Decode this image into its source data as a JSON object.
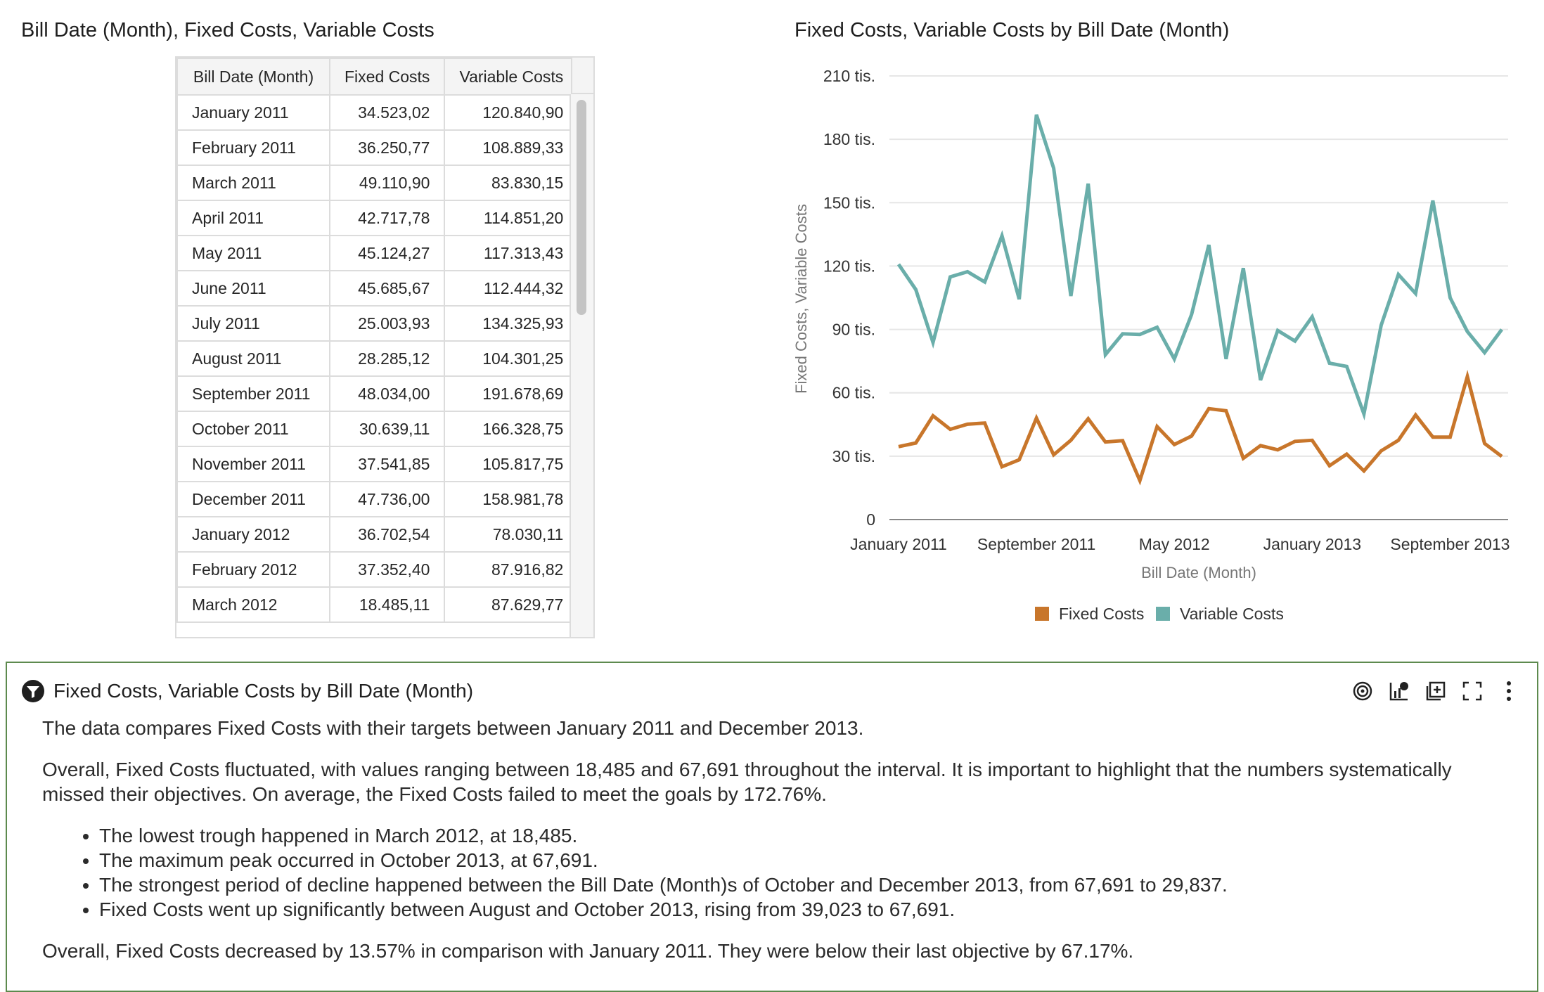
{
  "table_panel": {
    "title": "Bill Date (Month), Fixed Costs, Variable Costs",
    "columns": [
      "Bill Date (Month)",
      "Fixed Costs",
      "Variable Costs"
    ],
    "rows": [
      [
        "January 2011",
        "34.523,02",
        "120.840,90"
      ],
      [
        "February 2011",
        "36.250,77",
        "108.889,33"
      ],
      [
        "March 2011",
        "49.110,90",
        "83.830,15"
      ],
      [
        "April 2011",
        "42.717,78",
        "114.851,20"
      ],
      [
        "May 2011",
        "45.124,27",
        "117.313,43"
      ],
      [
        "June 2011",
        "45.685,67",
        "112.444,32"
      ],
      [
        "July 2011",
        "25.003,93",
        "134.325,93"
      ],
      [
        "August 2011",
        "28.285,12",
        "104.301,25"
      ],
      [
        "September 2011",
        "48.034,00",
        "191.678,69"
      ],
      [
        "October 2011",
        "30.639,11",
        "166.328,75"
      ],
      [
        "November 2011",
        "37.541,85",
        "105.817,75"
      ],
      [
        "December 2011",
        "47.736,00",
        "158.981,78"
      ],
      [
        "January 2012",
        "36.702,54",
        "78.030,11"
      ],
      [
        "February 2012",
        "37.352,40",
        "87.916,82"
      ],
      [
        "March 2012",
        "18.485,11",
        "87.629,77"
      ]
    ]
  },
  "chart_panel": {
    "title": "Fixed Costs, Variable Costs by Bill Date (Month)"
  },
  "chart_data": {
    "type": "line",
    "title": "Fixed Costs, Variable Costs by Bill Date (Month)",
    "xlabel": "Bill Date (Month)",
    "ylabel": "Fixed Costs, Variable Costs",
    "ylim": [
      0,
      210000
    ],
    "y_ticks": [
      0,
      30000,
      60000,
      90000,
      120000,
      150000,
      180000,
      210000
    ],
    "y_tick_labels": [
      "0",
      "30 tis.",
      "60 tis.",
      "90 tis.",
      "120 tis.",
      "150 tis.",
      "180 tis.",
      "210 tis."
    ],
    "x": [
      "2011-01",
      "2011-02",
      "2011-03",
      "2011-04",
      "2011-05",
      "2011-06",
      "2011-07",
      "2011-08",
      "2011-09",
      "2011-10",
      "2011-11",
      "2011-12",
      "2012-01",
      "2012-02",
      "2012-03",
      "2012-04",
      "2012-05",
      "2012-06",
      "2012-07",
      "2012-08",
      "2012-09",
      "2012-10",
      "2012-11",
      "2012-12",
      "2013-01",
      "2013-02",
      "2013-03",
      "2013-04",
      "2013-05",
      "2013-06",
      "2013-07",
      "2013-08",
      "2013-09",
      "2013-10",
      "2013-11",
      "2013-12"
    ],
    "x_tick_labels": [
      {
        "at": "2011-01",
        "label": "January 2011"
      },
      {
        "at": "2011-09",
        "label": "September 2011"
      },
      {
        "at": "2012-05",
        "label": "May 2012"
      },
      {
        "at": "2013-01",
        "label": "January 2013"
      },
      {
        "at": "2013-09",
        "label": "September 2013"
      }
    ],
    "series": [
      {
        "name": "Fixed Costs",
        "color": "#c8762b",
        "values": [
          34523,
          36251,
          49111,
          42718,
          45124,
          45686,
          25004,
          28285,
          48034,
          30639,
          37542,
          47736,
          36703,
          37352,
          18485,
          44000,
          35500,
          39500,
          52500,
          51500,
          29000,
          35000,
          33000,
          37000,
          37500,
          25500,
          31000,
          23000,
          32500,
          37500,
          49500,
          39023,
          39000,
          67691,
          36000,
          29837
        ]
      },
      {
        "name": "Variable Costs",
        "color": "#6aaeaa",
        "values": [
          120841,
          108889,
          83830,
          114851,
          117313,
          112444,
          134326,
          104301,
          191679,
          166329,
          105818,
          158982,
          78030,
          87917,
          87630,
          91000,
          76000,
          97000,
          130000,
          76000,
          119000,
          66000,
          89500,
          84500,
          96000,
          74000,
          72500,
          50000,
          92000,
          116000,
          107000,
          151000,
          105000,
          89000,
          79000,
          90000
        ]
      }
    ],
    "legend": "bottom",
    "grid": true
  },
  "narrative": {
    "title": "Fixed Costs, Variable Costs by Bill Date (Month)",
    "para1": "The data compares Fixed Costs with their targets between January 2011 and December 2013.",
    "para2": "Overall, Fixed Costs fluctuated, with values ranging between 18,485 and 67,691 throughout the interval. It is important to highlight that the numbers systematically missed their objectives. On average, the Fixed Costs failed to meet the goals by 172.76%.",
    "bullets": [
      "The lowest trough happened in March 2012, at 18,485.",
      "The maximum peak occurred in October 2013, at 67,691.",
      "The strongest period of decline happened between the Bill Date (Month)s of October and December 2013, from 67,691 to 29,837.",
      "Fixed Costs went up significantly between August and October 2013, rising from 39,023 to 67,691."
    ],
    "para3": "Overall, Fixed Costs decreased by 13.57% in comparison with January 2011. They were below their last objective by 67.17%.",
    "tools": [
      "target-icon",
      "chart-settings-icon",
      "add-to-canvas-icon",
      "fullscreen-icon",
      "more-options-icon"
    ]
  }
}
